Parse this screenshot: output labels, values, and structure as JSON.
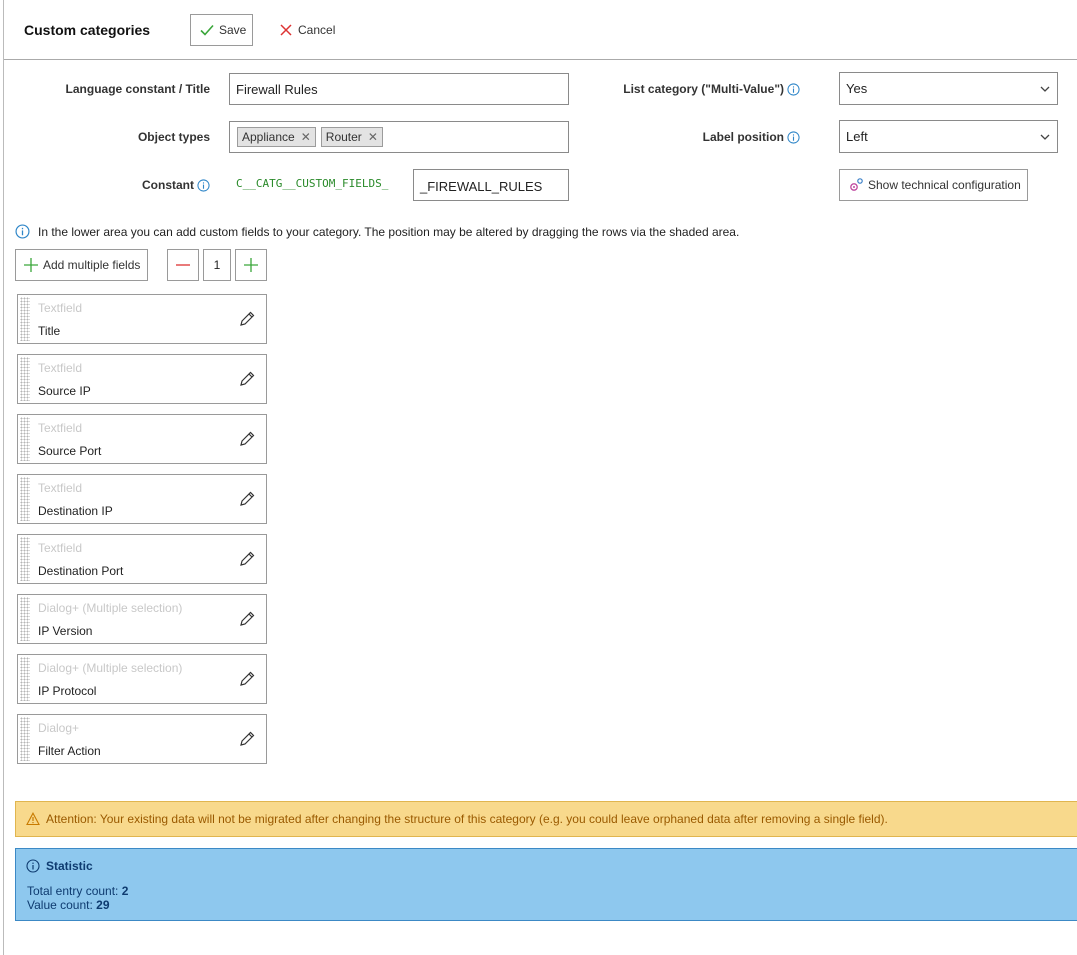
{
  "header": {
    "title": "Custom categories",
    "save_label": "Save",
    "cancel_label": "Cancel"
  },
  "form": {
    "title_label": "Language constant / Title",
    "title_value": "Firewall Rules",
    "object_types_label": "Object types",
    "object_types": [
      "Appliance",
      "Router"
    ],
    "constant_label": "Constant",
    "constant_prefix": "C__CATG__CUSTOM_FIELDS_",
    "constant_value": "_FIREWALL_RULES",
    "list_category_label": "List category (\"Multi-Value\")",
    "list_category_value": "Yes",
    "label_position_label": "Label position",
    "label_position_value": "Left",
    "tech_config_label": "Show technical configuration"
  },
  "hint": "In the lower area you can add custom fields to your category. The position may be altered by dragging the rows via the shaded area.",
  "toolbar": {
    "add_multiple_label": "Add multiple fields",
    "count_value": "1"
  },
  "fields": [
    {
      "type": "Textfield",
      "title": "Title"
    },
    {
      "type": "Textfield",
      "title": "Source IP"
    },
    {
      "type": "Textfield",
      "title": "Source Port"
    },
    {
      "type": "Textfield",
      "title": "Destination IP"
    },
    {
      "type": "Textfield",
      "title": "Destination Port"
    },
    {
      "type": "Dialog+ (Multiple selection)",
      "title": "IP Version"
    },
    {
      "type": "Dialog+ (Multiple selection)",
      "title": "IP Protocol"
    },
    {
      "type": "Dialog+",
      "title": "Filter Action"
    }
  ],
  "alert": "Attention: Your existing data will not be migrated after changing the structure of this category (e.g. you could leave orphaned data after removing a single field).",
  "statistic": {
    "title": "Statistic",
    "total_label": "Total entry count:",
    "total_value": "2",
    "value_label": "Value count:",
    "value_value": "29"
  },
  "icons": {
    "save": "check-icon",
    "cancel": "x-icon",
    "info": "info-icon",
    "gear": "gear-icon",
    "minus": "minus-icon",
    "plus": "plus-icon",
    "edit": "pencil-icon",
    "warning": "warning-icon"
  },
  "colors": {
    "save_check": "#3aa63a",
    "cancel_x": "#d33",
    "minus": "#d33",
    "plus": "#3aa63a",
    "info": "#2f86c8",
    "constant_prefix": "#2a8a2a"
  }
}
